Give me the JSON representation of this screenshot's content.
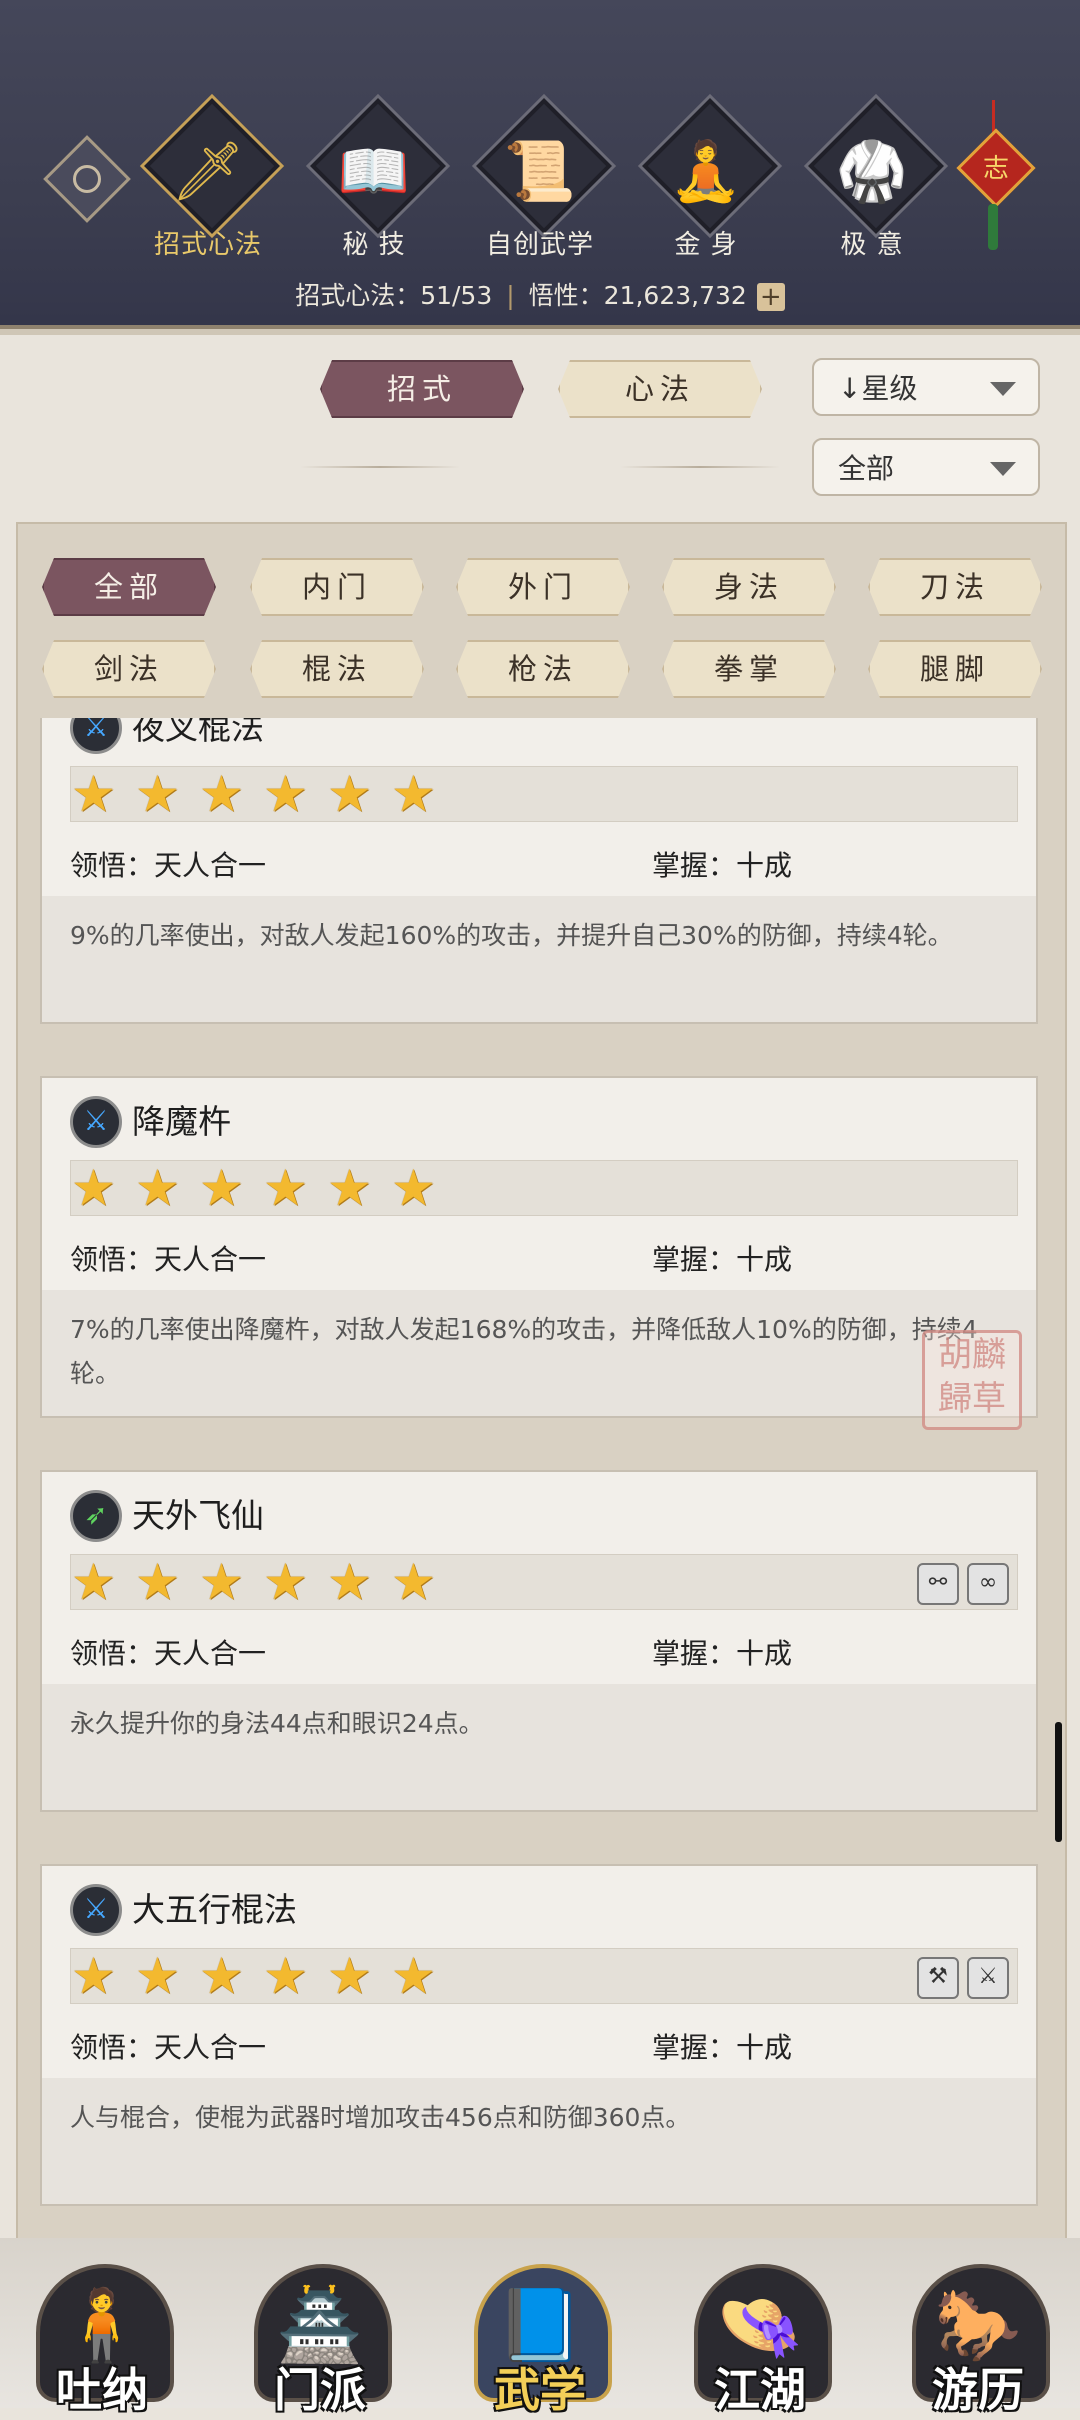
{
  "header": {
    "tabs": [
      {
        "label": "招式心法",
        "icon": "sword-icon",
        "glyph": "🗡",
        "active": true
      },
      {
        "label": "秘 技",
        "icon": "book-icon",
        "glyph": "📖",
        "active": false
      },
      {
        "label": "自创武学",
        "icon": "scroll-icon",
        "glyph": "📜",
        "active": false
      },
      {
        "label": "金 身",
        "icon": "meditation-icon",
        "glyph": "🧘",
        "active": false
      },
      {
        "label": "极 意",
        "icon": "fighter-stance-icon",
        "glyph": "🥋",
        "active": false
      }
    ],
    "knot_char": "志",
    "stats": {
      "moves_label": "招式心法：51/53",
      "insight_label": "悟性：21,623,732",
      "plus": "+"
    }
  },
  "filters": {
    "type_tabs": [
      {
        "label": "招式",
        "active": true
      },
      {
        "label": "心法",
        "active": false
      }
    ],
    "sort_dropdown": "↓星级",
    "scope_dropdown": "全部",
    "categories_row1": [
      "全部",
      "内门",
      "外门",
      "身法",
      "刀法"
    ],
    "categories_row2": [
      "剑法",
      "棍法",
      "枪法",
      "拳掌",
      "腿脚"
    ],
    "active_category": "全部"
  },
  "skills": [
    {
      "name": "夜叉棍法",
      "icon": "staff-icon",
      "stars": 6,
      "comprehension": "领悟：天人合一",
      "mastery": "掌握：十成",
      "description": "9%的几率使出，对敌人发起160%的攻击，并提升自己30%的防御，持续4轮。",
      "badges": []
    },
    {
      "name": "降魔杵",
      "icon": "staff-icon",
      "stars": 6,
      "comprehension": "领悟：天人合一",
      "mastery": "掌握：十成",
      "description": "7%的几率使出降魔杵，对敌人发起168%的攻击，并降低敌人10%的防御，持续4轮。",
      "badges": []
    },
    {
      "name": "天外飞仙",
      "icon": "movement-icon",
      "stars": 6,
      "comprehension": "领悟：天人合一",
      "mastery": "掌握：十成",
      "description": "永久提升你的身法44点和眼识24点。",
      "badges": [
        "link-badge-icon",
        "chain-badge-icon"
      ]
    },
    {
      "name": "大五行棍法",
      "icon": "staff-icon",
      "stars": 6,
      "comprehension": "领悟：天人合一",
      "mastery": "掌握：十成",
      "description": "人与棍合，使棍为武器时增加攻击456点和防御360点。",
      "badges": [
        "weapon-badge-icon",
        "sword-badge-icon"
      ]
    }
  ],
  "seal_text": "胡麟歸草",
  "bottom_nav": [
    {
      "label": "吐纳",
      "icon": "monk-figure-icon",
      "glyph": "🧍",
      "active": false
    },
    {
      "label": "门派",
      "icon": "sect-banner-icon",
      "glyph": "🏯",
      "active": false
    },
    {
      "label": "武学",
      "icon": "martial-book-icon",
      "glyph": "📘",
      "active": true
    },
    {
      "label": "江湖",
      "icon": "bamboo-hat-icon",
      "glyph": "👒",
      "active": false
    },
    {
      "label": "游历",
      "icon": "horse-icon",
      "glyph": "🐎",
      "active": false
    }
  ]
}
